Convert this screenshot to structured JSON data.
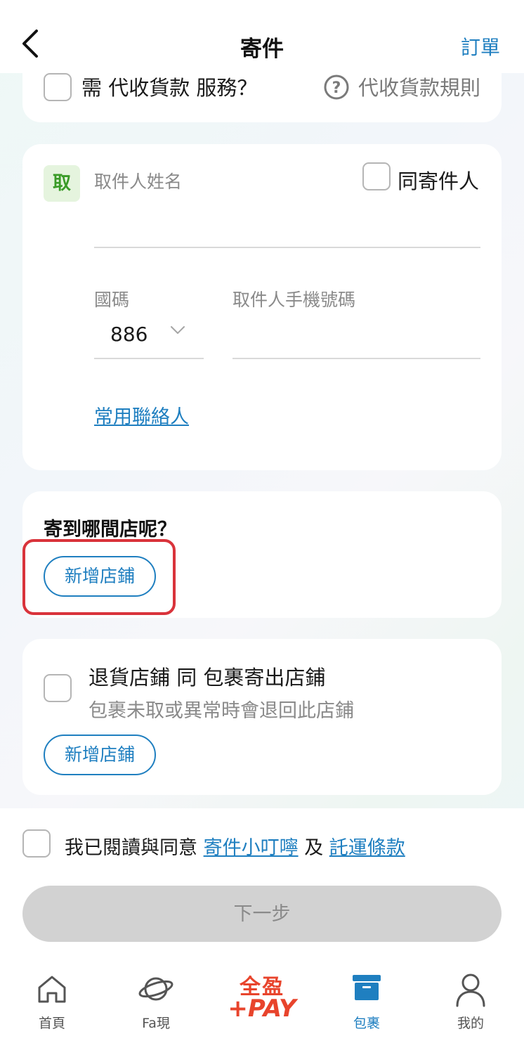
{
  "header": {
    "title": "寄件",
    "orders_label": "訂單"
  },
  "cod": {
    "label": "需 代收貨款 服務？",
    "rules_label": "代收貨款規則"
  },
  "recipient": {
    "badge": "取",
    "name_placeholder": "取件人姓名",
    "same_as_sender": "同寄件人",
    "country_code_label": "國碼",
    "country_code_value": "886",
    "phone_placeholder": "取件人手機號碼",
    "contacts_link": "常用聯絡人"
  },
  "destination_store": {
    "title": "寄到哪間店呢？",
    "add_button": "新增店鋪"
  },
  "return_store": {
    "title": "退貨店鋪 同 包裹寄出店鋪",
    "subtitle": "包裹未取或異常時會退回此店鋪",
    "add_button": "新增店鋪"
  },
  "agreement": {
    "prefix": "我已閱讀與同意",
    "link1": "寄件小叮嚀",
    "conj": "及",
    "link2": "託運條款"
  },
  "next_button": "下一步",
  "tabbar": {
    "home": "首頁",
    "fa": "Fa現",
    "pay_top": "全盈",
    "pay_bottom": "+PAY",
    "package": "包裹",
    "mine": "我的"
  },
  "colors": {
    "accent": "#1f7fc0",
    "highlight": "#d9333b",
    "pay_brand": "#e8442c",
    "badge_green": "#3a9b28"
  }
}
